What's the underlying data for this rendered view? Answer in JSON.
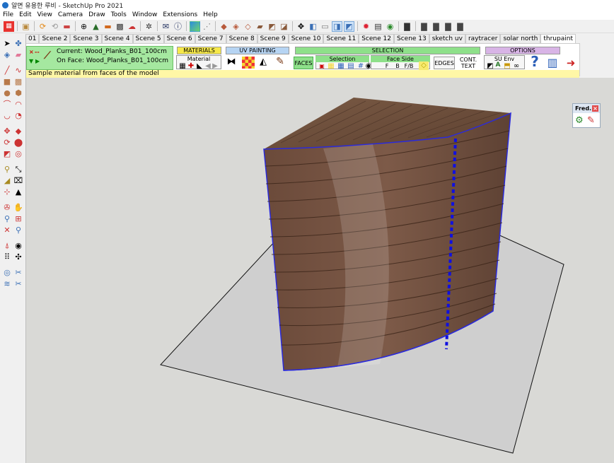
{
  "window": {
    "title": "알면 유용한 루비 - SketchUp Pro 2021"
  },
  "menu": [
    "File",
    "Edit",
    "View",
    "Camera",
    "Draw",
    "Tools",
    "Window",
    "Extensions",
    "Help"
  ],
  "scenes": [
    {
      "label": "01"
    },
    {
      "label": "Scene 2"
    },
    {
      "label": "Scene 3"
    },
    {
      "label": "Scene 4"
    },
    {
      "label": "Scene 5"
    },
    {
      "label": "Scene 6"
    },
    {
      "label": "Scene 7"
    },
    {
      "label": "Scene 8"
    },
    {
      "label": "Scene 9"
    },
    {
      "label": "Scene 10"
    },
    {
      "label": "Scene 11"
    },
    {
      "label": "Scene 12"
    },
    {
      "label": "Scene 13"
    },
    {
      "label": "sketch uv"
    },
    {
      "label": "raytracer"
    },
    {
      "label": "solar north"
    },
    {
      "label": "thrupaint",
      "active": true
    }
  ],
  "thrupaint": {
    "current_label": "Current: Wood_Planks_B01_100cm",
    "onface_label": "On Face: Wood_Planks_B01_100cm",
    "close_mark": "×",
    "dash_mark": "--",
    "down_mark": "▼",
    "play_mark": "▶",
    "headers": {
      "materials": "MATERIALS",
      "uv_painting": "UV PAINTING",
      "selection": "SELECTION",
      "options": "OPTIONS"
    },
    "material_label": "Material",
    "faces_label": "FACES",
    "selection_label": "Selection",
    "face_side_label": "Face Side",
    "face_side_f": "F",
    "face_side_b": "B",
    "face_side_fb": "F/B",
    "edges_label": "EDGES",
    "cont_label": "CONT.",
    "text_label": "TEXT",
    "su_env_label": "SU Env",
    "a_label": "A",
    "help_glyph": "?",
    "status_text": "Sample material from faces of the model",
    "colors": {
      "materials_header": "#f6e84a",
      "uv_header": "#b6d4f3",
      "selection_header": "#8ee08a",
      "options_header": "#d8b4e6",
      "current_panel": "#a5e8a0"
    }
  },
  "fred_panel": {
    "title": "Fred...",
    "close": "×"
  },
  "icons": {
    "toolbar": [
      "model-info-icon",
      "orbit-icon",
      "pan-icon",
      "undo-icon",
      "redo-icon",
      "components-icon",
      "shadows-icon",
      "fog-icon",
      "styles-icon",
      "match-photo-icon",
      "settings-icon",
      "email-icon",
      "info-icon",
      "color-icon",
      "xray-icon",
      "box-icon",
      "section-icon",
      "section-fill-icon",
      "paint-icon",
      "sandbox-icon",
      "solid-tools-icon",
      "move-icon",
      "view-iso-icon",
      "view-top-icon",
      "view-front-icon",
      "view-right-icon",
      "gear-icon",
      "layers-icon",
      "outliner-icon",
      "scene-icon",
      "warehouse-icon",
      "extension-icon",
      "share-icon",
      "export-icon"
    ]
  }
}
